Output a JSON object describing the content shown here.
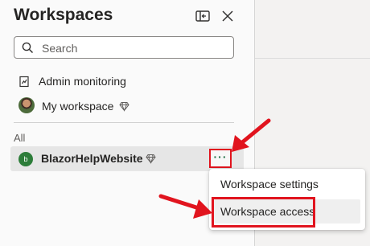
{
  "panel": {
    "title": "Workspaces",
    "search": {
      "placeholder": "Search",
      "value": ""
    },
    "nav": [
      {
        "label": "Admin monitoring",
        "icon": "admin-monitoring-icon"
      },
      {
        "label": "My workspace",
        "icon": "avatar",
        "badge_icon": "premium-diamond-icon"
      }
    ],
    "section_label": "All",
    "workspace": {
      "avatar_letter": "b",
      "avatar_color": "#2d7d3a",
      "name": "BlazorHelpWebsite",
      "badge_icon": "premium-diamond-icon",
      "more_label": "···"
    }
  },
  "context_menu": {
    "items": [
      {
        "label": "Workspace settings"
      },
      {
        "label": "Workspace access"
      }
    ]
  },
  "colors": {
    "highlight_red": "#e1141e",
    "panel_bg": "#fafafa",
    "selected_row_bg": "#e6e6e6"
  }
}
